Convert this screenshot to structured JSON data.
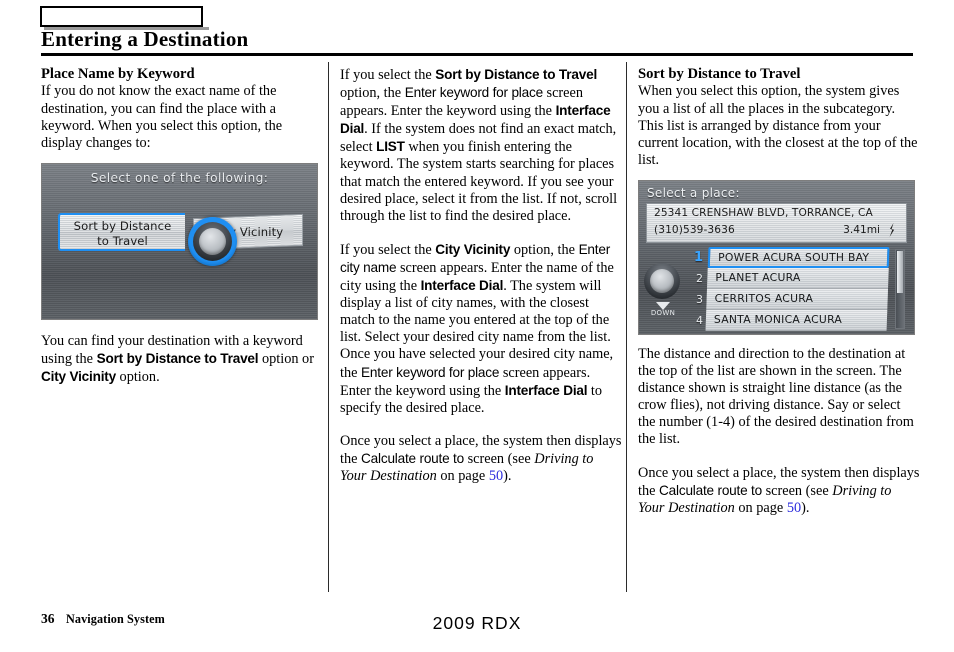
{
  "header": {
    "tab_marker_label": "",
    "title": "Entering a Destination"
  },
  "col1": {
    "heading": "Place Name by Keyword",
    "p1_a": "If you do not know the exact name of the destination, you can find the place with a keyword. When you select this option, the display changes to:",
    "p2_a": "You can find your destination with a keyword using the ",
    "p2_b": "Sort by Distance to Travel",
    "p2_c": " option or ",
    "p2_d": "City Vicinity",
    "p2_e": " option."
  },
  "col2": {
    "p1_a": "If you select the ",
    "p1_b": "Sort by Distance to Travel",
    "p1_c": " option, the ",
    "p1_d": "Enter keyword for place",
    "p1_e": " screen appears. Enter the keyword using the ",
    "p1_f": "Interface Dial",
    "p1_g": ". If the system does not find an exact match, select ",
    "p1_h": "LIST",
    "p1_i": " when you finish entering the keyword. The system starts searching for places that match the entered keyword. If you see your desired place, select it from the list. If not, scroll through the list to find the desired place.",
    "p2_a": "If you select the ",
    "p2_b": "City Vicinity",
    "p2_c": " option, the ",
    "p2_d": "Enter city name",
    "p2_e": " screen appears. Enter the name of the city using the ",
    "p2_f": "Interface Dial",
    "p2_g": ". The system will display a list of city names, with the closest match to the name you entered at the top of the list. Select your desired city name from the list. Once you have selected your desired city name, the ",
    "p2_h": "Enter keyword for place",
    "p2_i": " screen appears. Enter the keyword using the ",
    "p2_j": "Interface Dial",
    "p2_k": " to specify the desired place.",
    "p3_a": "Once you select a place, the system then displays the ",
    "p3_b": "Calculate route to",
    "p3_c": " screen (see ",
    "p3_d": "Driving to Your Destination",
    "p3_e": " on page ",
    "p3_f": "50",
    "p3_g": ")."
  },
  "col3": {
    "heading": "Sort by Distance to Travel",
    "p1": "When you select this option, the system gives you a list of all the places in the subcategory. This list is arranged by distance from your current location, with the closest at the top of the list.",
    "p2": "The distance and direction to the destination at the top of the list are shown in the screen. The distance shown is straight line distance (as the crow flies), not driving distance. Say or select the number (1-4) of the desired destination from the list.",
    "p3_a": "Once you select a place, the system then displays the ",
    "p3_b": "Calculate route to",
    "p3_c": " screen (see ",
    "p3_d": "Driving to Your Destination",
    "p3_e": " on page ",
    "p3_f": "50",
    "p3_g": ")."
  },
  "screen_a": {
    "title": "Select one of the following:",
    "option_sort_line1": "Sort by Distance",
    "option_sort_line2": "to Travel",
    "option_city": "City Vicinity",
    "highlight_color": "#1f8ff2",
    "dial_icon": "interface-dial-knob"
  },
  "screen_b": {
    "title": "Select a place:",
    "address": "25341 CRENSHAW BLVD, TORRANCE, CA",
    "phone": "(310)539-3636",
    "distance": "3.41mi",
    "direction_icon": "direction-arrow-icon",
    "down_label": "DOWN",
    "down_icon": "triangle-down-icon",
    "dial_icon": "interface-dial-knob",
    "highlight_color": "#1f8ff2",
    "rows": [
      {
        "num": "1",
        "label": "POWER ACURA SOUTH BAY",
        "selected": true
      },
      {
        "num": "2",
        "label": "PLANET ACURA",
        "selected": false
      },
      {
        "num": "3",
        "label": "CERRITOS ACURA",
        "selected": false
      },
      {
        "num": "4",
        "label": "SANTA MONICA ACURA",
        "selected": false
      }
    ]
  },
  "footer": {
    "page_number": "36",
    "section": "Navigation System",
    "model": "2009  RDX"
  }
}
